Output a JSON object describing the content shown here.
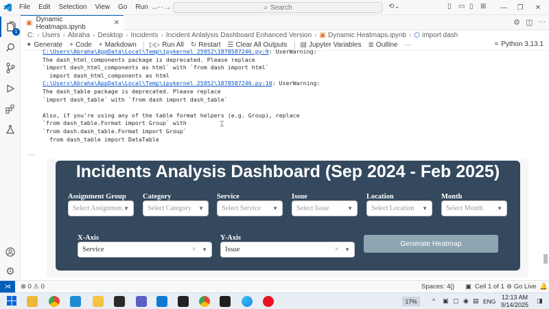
{
  "titlebar": {
    "menus": [
      "File",
      "Edit",
      "Selection",
      "View",
      "Go",
      "Run",
      "···"
    ],
    "search_placeholder": "Search"
  },
  "activity_bar": {
    "explorer_badge": "1"
  },
  "tab": {
    "label": "Dynamic Heatmaps.ipynb"
  },
  "breadcrumb": [
    "C:",
    "Users",
    "Abraha",
    "Desktop",
    "Incidents",
    "Incident Anlalysis Dashboard Enhanced Version",
    "Dynamic Heatmaps.ipynb",
    "import dash"
  ],
  "toolbar": {
    "generate": "Generate",
    "code": "Code",
    "markdown": "Markdown",
    "run_all": "Run All",
    "restart": "Restart",
    "clear_outputs": "Clear All Outputs",
    "jupyter_variables": "Jupyter Variables",
    "outline": "Outline",
    "more": "···",
    "kernel": "Python 3.13.1"
  },
  "output": {
    "line1_link": "C:\\Users\\Abraha\\AppData\\Local\\Temp\\ipykernel_25952\\1878587246.py:9",
    "line1_rest": ": UserWarning:",
    "line2": "The dash_html_components package is deprecated. Please replace",
    "line3": "`import dash_html_components as html` with `from dash import html`",
    "line4": "  import dash_html_components as html",
    "line5_link": "C:\\Users\\Abraha\\AppData\\Local\\Temp\\ipykernel_25952\\1878587246.py:10",
    "line5_rest": ": UserWarning:",
    "line6": "The dash_table package is deprecated. Please replace",
    "line7": "`import dash_table` with `from dash import dash_table`",
    "line8": "",
    "line9": "Also, if you're using any of the table format helpers (e.g. Group), replace",
    "line10": "`from dash_table.Format import Group` with",
    "line11": "`from dash.dash_table.Format import Group`",
    "line12": "  from dash_table import DataTable"
  },
  "cell_ellipsis": "···",
  "dashboard": {
    "title": "Incidents Analysis Dashboard (Sep 2024 - Feb 2025)",
    "filters": [
      {
        "label": "Assignment Group",
        "placeholder": "Select Assignmen..."
      },
      {
        "label": "Category",
        "placeholder": "Select Category"
      },
      {
        "label": "Service",
        "placeholder": "Select Service"
      },
      {
        "label": "Issue",
        "placeholder": "Select Issue"
      },
      {
        "label": "Location",
        "placeholder": "Select Location"
      },
      {
        "label": "Month",
        "placeholder": "Select Month"
      }
    ],
    "x_axis": {
      "label": "X-Axis",
      "value": "Service"
    },
    "y_axis": {
      "label": "Y-Axis",
      "value": "Issue"
    },
    "generate_button": "Generate Heatmap"
  },
  "statusbar": {
    "problems": "⊗ 0 ⚠ 0",
    "spaces": "Spaces: 4",
    "braces": "{}",
    "cell": "Cell 1 of 1",
    "go_live": "Go Live"
  },
  "taskbar": {
    "temp": "17%",
    "lang": "ENG",
    "time": "12:13 AM",
    "date": "9/14/2025"
  },
  "colors": {
    "accent": "#005fb8",
    "dashboard_bg": "#34495e",
    "generate_btn": "#8ea6b4",
    "link": "#0b57d0"
  }
}
